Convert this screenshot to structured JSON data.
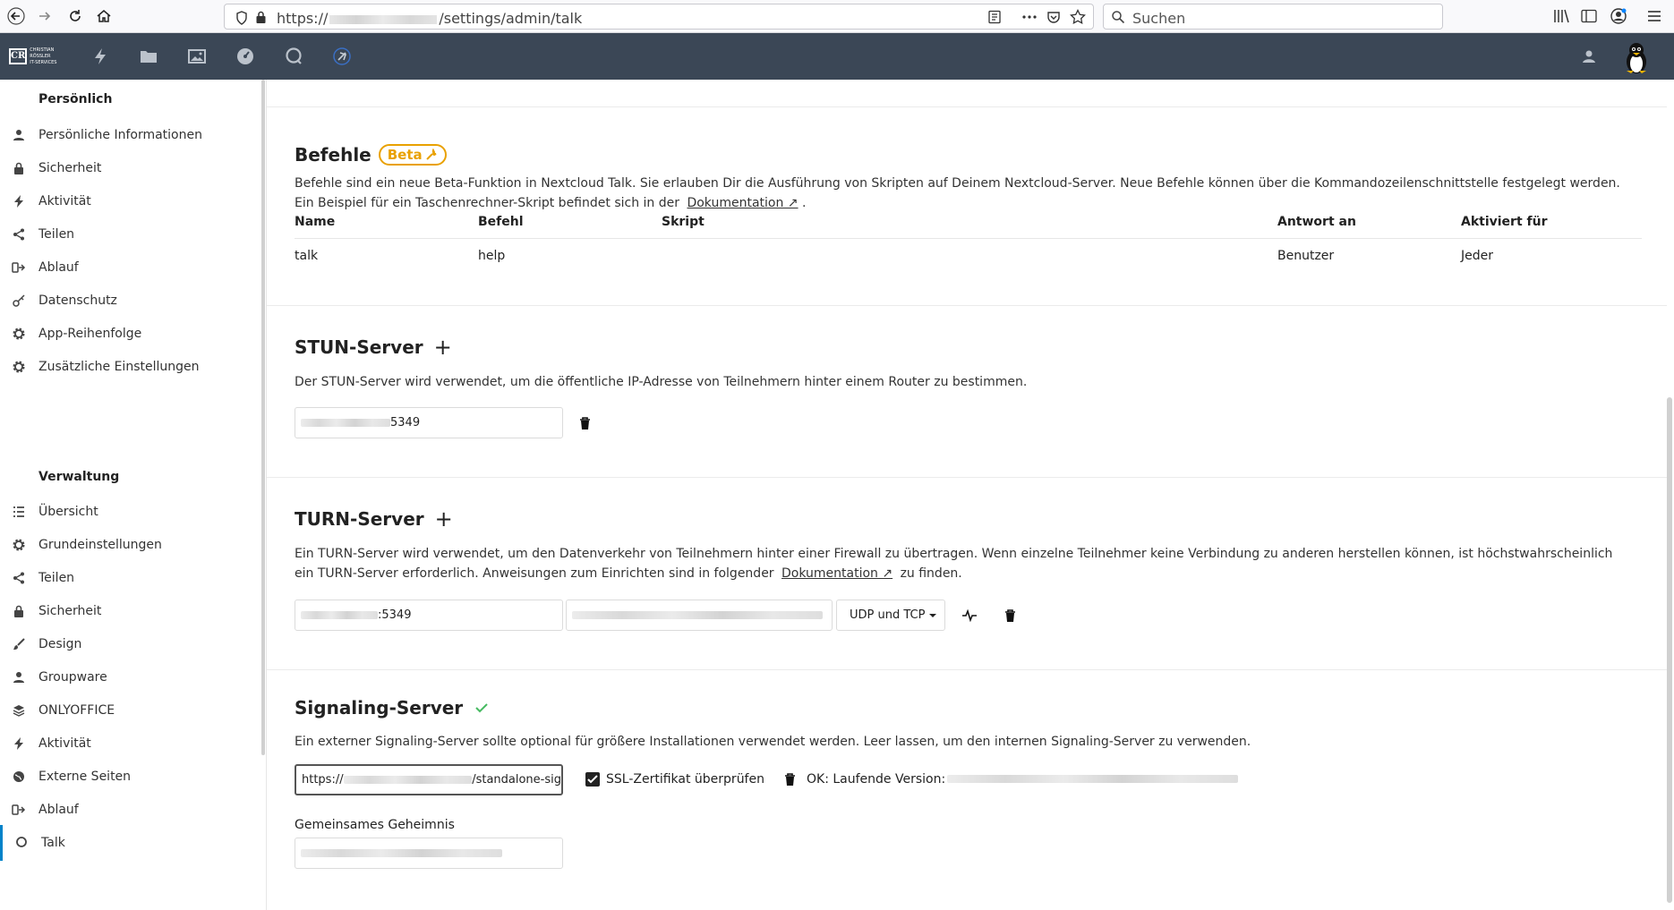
{
  "browser": {
    "url_prefix": "https://",
    "url_suffix": "/settings/admin/talk",
    "search_placeholder": "Suchen"
  },
  "sidebar": {
    "personal_title": "Persönlich",
    "personal_items": [
      {
        "label": "Persönliche Informationen",
        "icon": "person-icon"
      },
      {
        "label": "Sicherheit",
        "icon": "lock-icon"
      },
      {
        "label": "Aktivität",
        "icon": "activity-icon"
      },
      {
        "label": "Teilen",
        "icon": "share-icon"
      },
      {
        "label": "Ablauf",
        "icon": "flow-icon"
      },
      {
        "label": "Datenschutz",
        "icon": "key-icon"
      },
      {
        "label": "App-Reihenfolge",
        "icon": "gear-icon"
      },
      {
        "label": "Zusätzliche Einstellungen",
        "icon": "gear-icon"
      }
    ],
    "admin_title": "Verwaltung",
    "admin_items": [
      {
        "label": "Übersicht",
        "icon": "list-icon"
      },
      {
        "label": "Grundeinstellungen",
        "icon": "gear-icon"
      },
      {
        "label": "Teilen",
        "icon": "share-icon"
      },
      {
        "label": "Sicherheit",
        "icon": "lock-icon"
      },
      {
        "label": "Design",
        "icon": "brush-icon"
      },
      {
        "label": "Groupware",
        "icon": "groupware-icon"
      },
      {
        "label": "ONLYOFFICE",
        "icon": "layers-icon"
      },
      {
        "label": "Aktivität",
        "icon": "activity-icon"
      },
      {
        "label": "Externe Seiten",
        "icon": "globe-icon"
      },
      {
        "label": "Ablauf",
        "icon": "flow-icon"
      },
      {
        "label": "Talk",
        "icon": "talk-icon"
      }
    ]
  },
  "commands": {
    "title": "Befehle",
    "beta_label": "Beta",
    "description": "Befehle sind ein neue Beta-Funktion in Nextcloud Talk. Sie erlauben Dir die Ausführung von Skripten auf Deinem Nextcloud-Server. Neue Befehle können über die Kommandozeilenschnittstelle festgelegt werden. Ein Beispiel für ein Taschenrechner-Skript befindet sich in der",
    "doc_link": "Dokumentation ↗",
    "headers": [
      "Name",
      "Befehl",
      "Skript",
      "Antwort an",
      "Aktiviert für"
    ],
    "rows": [
      {
        "name": "talk",
        "command": "help",
        "script": "",
        "response": "Benutzer",
        "enabled": "Jeder"
      }
    ]
  },
  "stun": {
    "title": "STUN-Server",
    "description": "Der STUN-Server wird verwendet, um die öffentliche IP-Adresse von Teilnehmern hinter einem Router zu bestimmen.",
    "server_value_suffix": "5349"
  },
  "turn": {
    "title": "TURN-Server",
    "description": "Ein TURN-Server wird verwendet, um den Datenverkehr von Teilnehmern hinter einer Firewall zu übertragen. Wenn einzelne Teilnehmer keine Verbindung zu anderen herstellen können, ist höchstwahrscheinlich ein TURN-Server erforderlich. Anweisungen zum Einrichten sind in folgender",
    "doc_link": "Dokumentation ↗",
    "description_end": "zu finden.",
    "server_value_suffix": ":5349",
    "protocol": "UDP und TCP"
  },
  "signaling": {
    "title": "Signaling-Server",
    "description": "Ein externer Signaling-Server sollte optional für größere Installationen verwendet werden. Leer lassen, um den internen Signaling-Server zu verwenden.",
    "url_prefix": "https://",
    "url_suffix": "/standalone-sig",
    "ssl_label": "SSL-Zertifikat überprüfen",
    "status_label": "OK: Laufende Version:",
    "secret_label": "Gemeinsames Geheimnis"
  },
  "colors": {
    "header_bg": "#3b4756",
    "accent": "#0082c9",
    "beta": "#e9a100",
    "success": "#46ba61"
  }
}
